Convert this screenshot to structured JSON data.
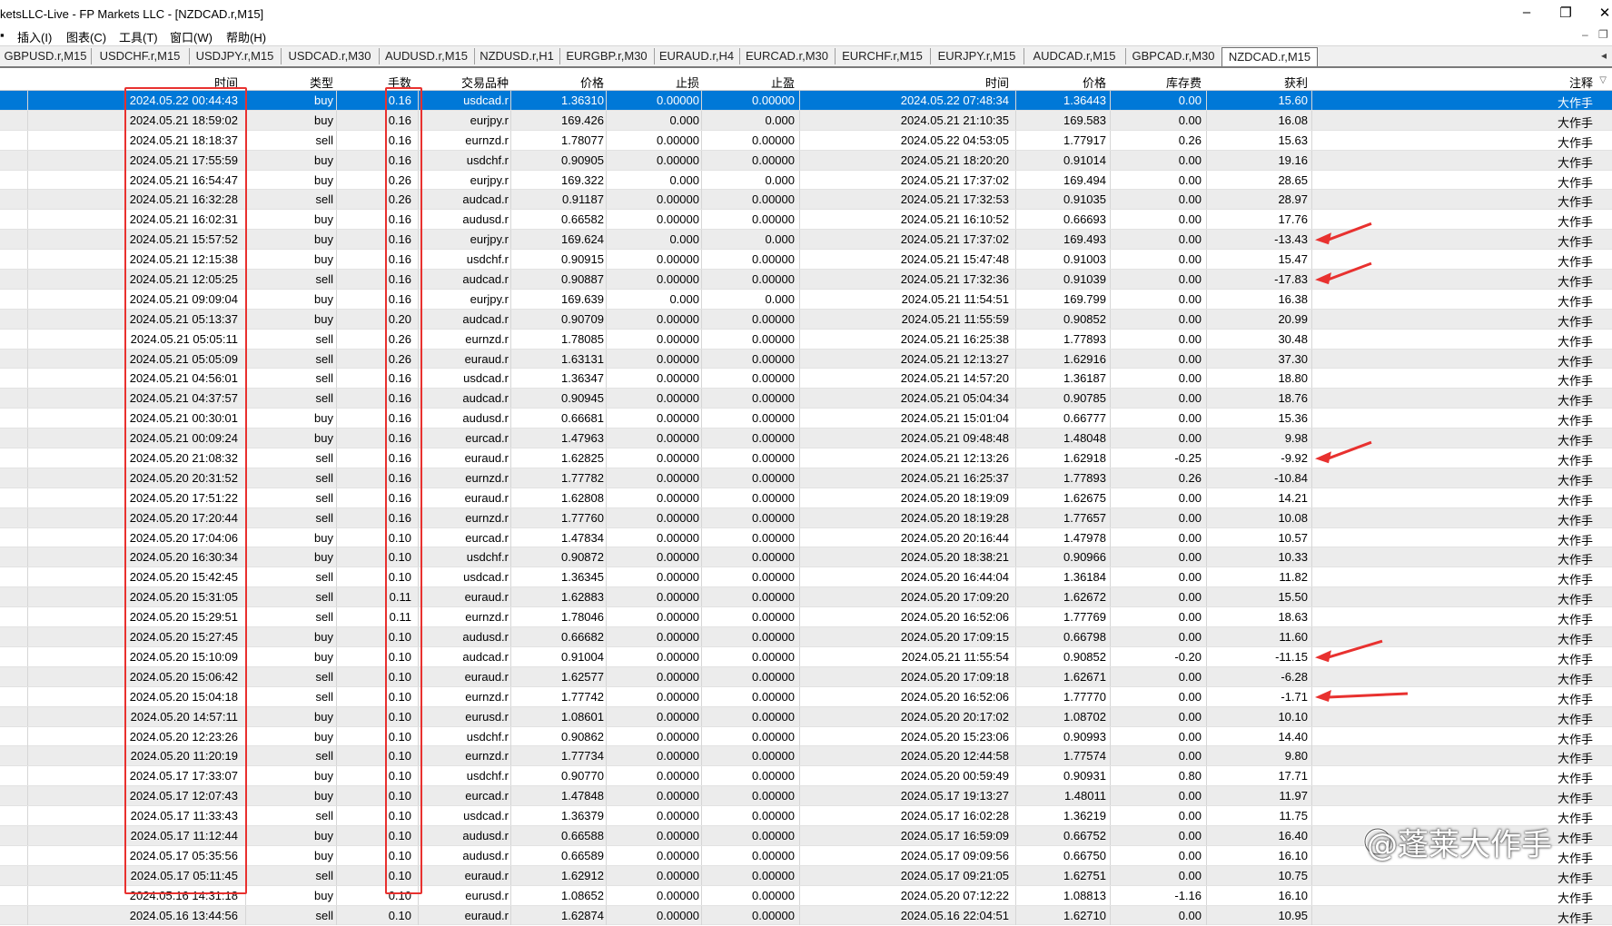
{
  "window": {
    "title": "ketsLLC-Live - FP Markets LLC - [NZDCAD.r,M15]",
    "minimize": "–",
    "restore": "❐",
    "close": "✕"
  },
  "menu": {
    "items": [
      "插入(I)",
      "图表(C)",
      "工具(T)",
      "窗口(W)",
      "帮助(H)"
    ]
  },
  "tabs": {
    "items": [
      "GBPUSD.r,M15",
      "USDCHF.r,M15",
      "USDJPY.r,M15",
      "USDCAD.r,M30",
      "AUDUSD.r,M15",
      "NZDUSD.r,H1",
      "EURGBP.r,M30",
      "EURAUD.r,H4",
      "EURCAD.r,M30",
      "EURCHF.r,M15",
      "EURJPY.r,M15",
      "AUDCAD.r,M15",
      "GBPCAD.r,M30",
      "NZDCAD.r,M15"
    ],
    "active_index": 13
  },
  "columns": {
    "open_time": "时间",
    "type": "类型",
    "lots": "手数",
    "symbol": "交易品种",
    "open_price": "价格",
    "sl": "止损",
    "tp": "止盈",
    "close_time": "时间",
    "close_price": "价格",
    "swap": "库存费",
    "profit": "获利",
    "comment": "注释"
  },
  "rows": [
    [
      "2024.05.22 00:44:43",
      "buy",
      "0.16",
      "usdcad.r",
      "1.36310",
      "0.00000",
      "0.00000",
      "2024.05.22 07:48:34",
      "1.36443",
      "0.00",
      "15.60",
      "大作手"
    ],
    [
      "2024.05.21 18:59:02",
      "buy",
      "0.16",
      "eurjpy.r",
      "169.426",
      "0.000",
      "0.000",
      "2024.05.21 21:10:35",
      "169.583",
      "0.00",
      "16.08",
      "大作手"
    ],
    [
      "2024.05.21 18:18:37",
      "sell",
      "0.16",
      "eurnzd.r",
      "1.78077",
      "0.00000",
      "0.00000",
      "2024.05.22 04:53:05",
      "1.77917",
      "0.26",
      "15.63",
      "大作手"
    ],
    [
      "2024.05.21 17:55:59",
      "buy",
      "0.16",
      "usdchf.r",
      "0.90905",
      "0.00000",
      "0.00000",
      "2024.05.21 18:20:20",
      "0.91014",
      "0.00",
      "19.16",
      "大作手"
    ],
    [
      "2024.05.21 16:54:47",
      "buy",
      "0.26",
      "eurjpy.r",
      "169.322",
      "0.000",
      "0.000",
      "2024.05.21 17:37:02",
      "169.494",
      "0.00",
      "28.65",
      "大作手"
    ],
    [
      "2024.05.21 16:32:28",
      "sell",
      "0.26",
      "audcad.r",
      "0.91187",
      "0.00000",
      "0.00000",
      "2024.05.21 17:32:53",
      "0.91035",
      "0.00",
      "28.97",
      "大作手"
    ],
    [
      "2024.05.21 16:02:31",
      "buy",
      "0.16",
      "audusd.r",
      "0.66582",
      "0.00000",
      "0.00000",
      "2024.05.21 16:10:52",
      "0.66693",
      "0.00",
      "17.76",
      "大作手"
    ],
    [
      "2024.05.21 15:57:52",
      "buy",
      "0.16",
      "eurjpy.r",
      "169.624",
      "0.000",
      "0.000",
      "2024.05.21 17:37:02",
      "169.493",
      "0.00",
      "-13.43",
      "大作手"
    ],
    [
      "2024.05.21 12:15:38",
      "buy",
      "0.16",
      "usdchf.r",
      "0.90915",
      "0.00000",
      "0.00000",
      "2024.05.21 15:47:48",
      "0.91003",
      "0.00",
      "15.47",
      "大作手"
    ],
    [
      "2024.05.21 12:05:25",
      "sell",
      "0.16",
      "audcad.r",
      "0.90887",
      "0.00000",
      "0.00000",
      "2024.05.21 17:32:36",
      "0.91039",
      "0.00",
      "-17.83",
      "大作手"
    ],
    [
      "2024.05.21 09:09:04",
      "buy",
      "0.16",
      "eurjpy.r",
      "169.639",
      "0.000",
      "0.000",
      "2024.05.21 11:54:51",
      "169.799",
      "0.00",
      "16.38",
      "大作手"
    ],
    [
      "2024.05.21 05:13:37",
      "buy",
      "0.20",
      "audcad.r",
      "0.90709",
      "0.00000",
      "0.00000",
      "2024.05.21 11:55:59",
      "0.90852",
      "0.00",
      "20.99",
      "大作手"
    ],
    [
      "2024.05.21 05:05:11",
      "sell",
      "0.26",
      "eurnzd.r",
      "1.78085",
      "0.00000",
      "0.00000",
      "2024.05.21 16:25:38",
      "1.77893",
      "0.00",
      "30.48",
      "大作手"
    ],
    [
      "2024.05.21 05:05:09",
      "sell",
      "0.26",
      "euraud.r",
      "1.63131",
      "0.00000",
      "0.00000",
      "2024.05.21 12:13:27",
      "1.62916",
      "0.00",
      "37.30",
      "大作手"
    ],
    [
      "2024.05.21 04:56:01",
      "sell",
      "0.16",
      "usdcad.r",
      "1.36347",
      "0.00000",
      "0.00000",
      "2024.05.21 14:57:20",
      "1.36187",
      "0.00",
      "18.80",
      "大作手"
    ],
    [
      "2024.05.21 04:37:57",
      "sell",
      "0.16",
      "audcad.r",
      "0.90945",
      "0.00000",
      "0.00000",
      "2024.05.21 05:04:34",
      "0.90785",
      "0.00",
      "18.76",
      "大作手"
    ],
    [
      "2024.05.21 00:30:01",
      "buy",
      "0.16",
      "audusd.r",
      "0.66681",
      "0.00000",
      "0.00000",
      "2024.05.21 15:01:04",
      "0.66777",
      "0.00",
      "15.36",
      "大作手"
    ],
    [
      "2024.05.21 00:09:24",
      "buy",
      "0.16",
      "eurcad.r",
      "1.47963",
      "0.00000",
      "0.00000",
      "2024.05.21 09:48:48",
      "1.48048",
      "0.00",
      "9.98",
      "大作手"
    ],
    [
      "2024.05.20 21:08:32",
      "sell",
      "0.16",
      "euraud.r",
      "1.62825",
      "0.00000",
      "0.00000",
      "2024.05.21 12:13:26",
      "1.62918",
      "-0.25",
      "-9.92",
      "大作手"
    ],
    [
      "2024.05.20 20:31:52",
      "sell",
      "0.16",
      "eurnzd.r",
      "1.77782",
      "0.00000",
      "0.00000",
      "2024.05.21 16:25:37",
      "1.77893",
      "0.26",
      "-10.84",
      "大作手"
    ],
    [
      "2024.05.20 17:51:22",
      "sell",
      "0.16",
      "euraud.r",
      "1.62808",
      "0.00000",
      "0.00000",
      "2024.05.20 18:19:09",
      "1.62675",
      "0.00",
      "14.21",
      "大作手"
    ],
    [
      "2024.05.20 17:20:44",
      "sell",
      "0.16",
      "eurnzd.r",
      "1.77760",
      "0.00000",
      "0.00000",
      "2024.05.20 18:19:28",
      "1.77657",
      "0.00",
      "10.08",
      "大作手"
    ],
    [
      "2024.05.20 17:04:06",
      "buy",
      "0.10",
      "eurcad.r",
      "1.47834",
      "0.00000",
      "0.00000",
      "2024.05.20 20:16:44",
      "1.47978",
      "0.00",
      "10.57",
      "大作手"
    ],
    [
      "2024.05.20 16:30:34",
      "buy",
      "0.10",
      "usdchf.r",
      "0.90872",
      "0.00000",
      "0.00000",
      "2024.05.20 18:38:21",
      "0.90966",
      "0.00",
      "10.33",
      "大作手"
    ],
    [
      "2024.05.20 15:42:45",
      "sell",
      "0.10",
      "usdcad.r",
      "1.36345",
      "0.00000",
      "0.00000",
      "2024.05.20 16:44:04",
      "1.36184",
      "0.00",
      "11.82",
      "大作手"
    ],
    [
      "2024.05.20 15:31:05",
      "sell",
      "0.11",
      "euraud.r",
      "1.62883",
      "0.00000",
      "0.00000",
      "2024.05.20 17:09:20",
      "1.62672",
      "0.00",
      "15.50",
      "大作手"
    ],
    [
      "2024.05.20 15:29:51",
      "sell",
      "0.11",
      "eurnzd.r",
      "1.78046",
      "0.00000",
      "0.00000",
      "2024.05.20 16:52:06",
      "1.77769",
      "0.00",
      "18.63",
      "大作手"
    ],
    [
      "2024.05.20 15:27:45",
      "buy",
      "0.10",
      "audusd.r",
      "0.66682",
      "0.00000",
      "0.00000",
      "2024.05.20 17:09:15",
      "0.66798",
      "0.00",
      "11.60",
      "大作手"
    ],
    [
      "2024.05.20 15:10:09",
      "buy",
      "0.10",
      "audcad.r",
      "0.91004",
      "0.00000",
      "0.00000",
      "2024.05.21 11:55:54",
      "0.90852",
      "-0.20",
      "-11.15",
      "大作手"
    ],
    [
      "2024.05.20 15:06:42",
      "sell",
      "0.10",
      "euraud.r",
      "1.62577",
      "0.00000",
      "0.00000",
      "2024.05.20 17:09:18",
      "1.62671",
      "0.00",
      "-6.28",
      "大作手"
    ],
    [
      "2024.05.20 15:04:18",
      "sell",
      "0.10",
      "eurnzd.r",
      "1.77742",
      "0.00000",
      "0.00000",
      "2024.05.20 16:52:06",
      "1.77770",
      "0.00",
      "-1.71",
      "大作手"
    ],
    [
      "2024.05.20 14:57:11",
      "buy",
      "0.10",
      "eurusd.r",
      "1.08601",
      "0.00000",
      "0.00000",
      "2024.05.20 20:17:02",
      "1.08702",
      "0.00",
      "10.10",
      "大作手"
    ],
    [
      "2024.05.20 12:23:26",
      "buy",
      "0.10",
      "usdchf.r",
      "0.90862",
      "0.00000",
      "0.00000",
      "2024.05.20 15:23:06",
      "0.90993",
      "0.00",
      "14.40",
      "大作手"
    ],
    [
      "2024.05.20 11:20:19",
      "sell",
      "0.10",
      "eurnzd.r",
      "1.77734",
      "0.00000",
      "0.00000",
      "2024.05.20 12:44:58",
      "1.77574",
      "0.00",
      "9.80",
      "大作手"
    ],
    [
      "2024.05.17 17:33:07",
      "buy",
      "0.10",
      "usdchf.r",
      "0.90770",
      "0.00000",
      "0.00000",
      "2024.05.20 00:59:49",
      "0.90931",
      "0.80",
      "17.71",
      "大作手"
    ],
    [
      "2024.05.17 12:07:43",
      "buy",
      "0.10",
      "eurcad.r",
      "1.47848",
      "0.00000",
      "0.00000",
      "2024.05.17 19:13:27",
      "1.48011",
      "0.00",
      "11.97",
      "大作手"
    ],
    [
      "2024.05.17 11:33:43",
      "sell",
      "0.10",
      "usdcad.r",
      "1.36379",
      "0.00000",
      "0.00000",
      "2024.05.17 16:02:28",
      "1.36219",
      "0.00",
      "11.75",
      "大作手"
    ],
    [
      "2024.05.17 11:12:44",
      "buy",
      "0.10",
      "audusd.r",
      "0.66588",
      "0.00000",
      "0.00000",
      "2024.05.17 16:59:09",
      "0.66752",
      "0.00",
      "16.40",
      "大作手"
    ],
    [
      "2024.05.17 05:35:56",
      "buy",
      "0.10",
      "audusd.r",
      "0.66589",
      "0.00000",
      "0.00000",
      "2024.05.17 09:09:56",
      "0.66750",
      "0.00",
      "16.10",
      "大作手"
    ],
    [
      "2024.05.17 05:11:45",
      "sell",
      "0.10",
      "euraud.r",
      "1.62912",
      "0.00000",
      "0.00000",
      "2024.05.17 09:21:05",
      "1.62751",
      "0.00",
      "10.75",
      "大作手"
    ],
    [
      "2024.05.16 14:31:18",
      "buy",
      "0.10",
      "eurusd.r",
      "1.08652",
      "0.00000",
      "0.00000",
      "2024.05.20 07:12:22",
      "1.08813",
      "-1.16",
      "16.10",
      "大作手"
    ],
    [
      "2024.05.16 13:44:56",
      "sell",
      "0.10",
      "euraud.r",
      "1.62874",
      "0.00000",
      "0.00000",
      "2024.05.16 22:04:51",
      "1.62710",
      "0.00",
      "10.95",
      "大作手"
    ]
  ],
  "selected_row": 0,
  "arrows_on_rows": [
    7,
    9,
    18,
    28,
    30
  ],
  "watermark": {
    "text": "@蓬莱大作手"
  },
  "colors": {
    "selection": "#0078d7",
    "annotation": "#e8312f",
    "alt_row": "#ececec"
  }
}
